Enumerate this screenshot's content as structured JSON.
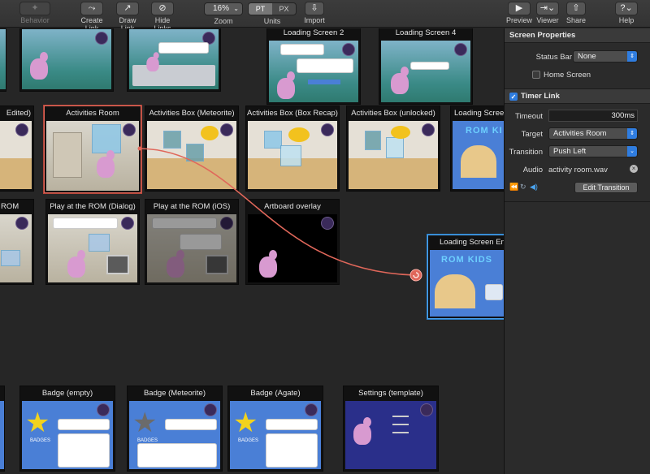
{
  "toolbar": {
    "behavior": "Behavior",
    "create_link": "Create Link",
    "draw_link": "Draw Link",
    "hide_links": "Hide Links",
    "zoom_value": "16%",
    "zoom_label": "Zoom",
    "units_pt": "PT",
    "units_px": "PX",
    "units_label": "Units",
    "import": "Import",
    "preview": "Preview",
    "viewer": "Viewer",
    "share": "Share",
    "help": "Help"
  },
  "screens": {
    "row0": [
      "",
      "",
      "Loading Screen 2",
      "Loading Screen 4"
    ],
    "row1": [
      "Edited)",
      "Activities Room",
      "Activities Box (Meteorite)",
      "Activities Box (Box Recap)",
      "Activities Box (unlocked)",
      "Loading Screen"
    ],
    "row2": [
      "ROM",
      "Play at the ROM (Dialog)",
      "Play at the ROM (iOS)",
      "Artboard overlay",
      "Loading Screen En"
    ],
    "row3": [
      "Badge (empty)",
      "Badge (Meteorite)",
      "Badge (Agate)",
      "Settings (template)"
    ],
    "rom_kids": "ROM KIDS",
    "rom_k": "ROM KI",
    "badges": "BADGES"
  },
  "inspector": {
    "screen_props_title": "Screen Properties",
    "status_bar_label": "Status Bar",
    "status_bar_value": "None",
    "home_screen_label": "Home Screen",
    "timer_link_title": "Timer Link",
    "timeout_label": "Timeout",
    "timeout_value": "300ms",
    "target_label": "Target",
    "target_value": "Activities Room",
    "transition_label": "Transition",
    "transition_value": "Push Left",
    "audio_label": "Audio",
    "audio_value": "activity room.wav",
    "edit_transition": "Edit Transition"
  },
  "colors": {
    "accent_blue": "#2f7de0",
    "link_red": "#e0675a",
    "selection_blue": "#4aa3ee"
  }
}
